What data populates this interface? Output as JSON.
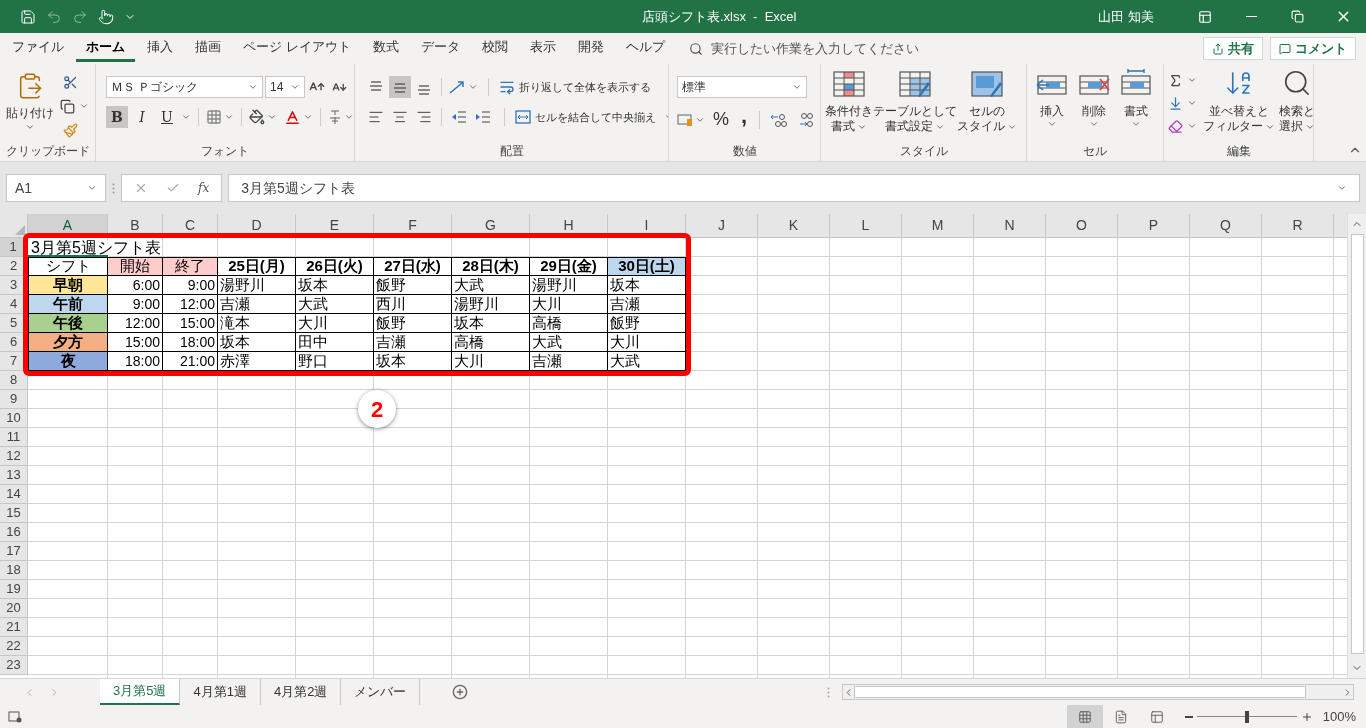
{
  "title_bar": {
    "document": "店頭シフト表.xlsx  -  Excel",
    "user": "山田 知美"
  },
  "ribbon_tabs": [
    {
      "label": "ファイル",
      "selected": false
    },
    {
      "label": "ホーム",
      "selected": true
    },
    {
      "label": "挿入",
      "selected": false
    },
    {
      "label": "描画",
      "selected": false
    },
    {
      "label": "ページ レイアウト",
      "selected": false
    },
    {
      "label": "数式",
      "selected": false
    },
    {
      "label": "データ",
      "selected": false
    },
    {
      "label": "校閲",
      "selected": false
    },
    {
      "label": "表示",
      "selected": false
    },
    {
      "label": "開発",
      "selected": false
    },
    {
      "label": "ヘルプ",
      "selected": false
    }
  ],
  "tell_me": {
    "placeholder": "実行したい作業を入力してください"
  },
  "share_button": "共有",
  "comment_button": "コメント",
  "clipboard": {
    "paste": "貼り付け",
    "group": "クリップボード"
  },
  "font": {
    "name": "ＭＳ Ｐゴシック",
    "size": "14",
    "toggles": [
      {
        "label": "B",
        "pressed": true
      },
      {
        "label": "I",
        "pressed": false
      },
      {
        "label": "U",
        "pressed": false
      }
    ],
    "group": "フォント"
  },
  "alignment": {
    "vertical": [
      {
        "kind": "top",
        "selected": false
      },
      {
        "kind": "middle",
        "selected": true
      },
      {
        "kind": "bottom",
        "selected": false
      }
    ],
    "horizontal": [
      {
        "kind": "left",
        "selected": false
      },
      {
        "kind": "center",
        "selected": false
      },
      {
        "kind": "right",
        "selected": false
      }
    ],
    "wrap": "折り返して全体を表示する",
    "merge": "セルを結合して中央揃え",
    "group": "配置"
  },
  "number": {
    "format": "標準",
    "percent": "%",
    "comma": ",",
    "group": "数値"
  },
  "styles": {
    "buttons": [
      {
        "kind": "conditional",
        "lines": [
          "条件付き",
          "書式"
        ]
      },
      {
        "kind": "table",
        "lines": [
          "テーブルとして",
          "書式設定"
        ]
      },
      {
        "kind": "cell",
        "lines": [
          "セルの",
          "スタイル"
        ]
      }
    ],
    "group": "スタイル"
  },
  "cells": {
    "buttons": [
      {
        "kind": "insert",
        "label": "挿入"
      },
      {
        "kind": "delete",
        "label": "削除"
      },
      {
        "kind": "format",
        "label": "書式"
      }
    ],
    "group": "セル"
  },
  "editing": {
    "buttons": [
      {
        "kind": "sort",
        "lines": [
          "並べ替えと",
          "フィルター"
        ]
      },
      {
        "kind": "find",
        "lines": [
          "検索と",
          "選択"
        ]
      }
    ],
    "group": "編集"
  },
  "formula_bar": {
    "name_box": "A1",
    "fx": "fx",
    "formula": "3月第5週シフト表"
  },
  "sheet": {
    "columns": [
      {
        "label": "A",
        "selected": true
      },
      {
        "label": "B",
        "selected": false
      },
      {
        "label": "C",
        "selected": false
      },
      {
        "label": "D",
        "selected": false
      },
      {
        "label": "E",
        "selected": false
      },
      {
        "label": "F",
        "selected": false
      },
      {
        "label": "G",
        "selected": false
      },
      {
        "label": "H",
        "selected": false
      },
      {
        "label": "I",
        "selected": false
      },
      {
        "label": "J",
        "selected": false
      },
      {
        "label": "K",
        "selected": false
      },
      {
        "label": "L",
        "selected": false
      },
      {
        "label": "M",
        "selected": false
      },
      {
        "label": "N",
        "selected": false
      },
      {
        "label": "O",
        "selected": false
      },
      {
        "label": "P",
        "selected": false
      },
      {
        "label": "Q",
        "selected": false
      },
      {
        "label": "R",
        "selected": false
      }
    ],
    "row_numbers": [
      {
        "label": "1",
        "selected": true
      },
      {
        "label": "2",
        "selected": false
      },
      {
        "label": "3",
        "selected": false
      },
      {
        "label": "4",
        "selected": false
      },
      {
        "label": "5",
        "selected": false
      },
      {
        "label": "6",
        "selected": false
      },
      {
        "label": "7",
        "selected": false
      },
      {
        "label": "8",
        "selected": false
      },
      {
        "label": "9",
        "selected": false
      },
      {
        "label": "10",
        "selected": false
      },
      {
        "label": "11",
        "selected": false
      },
      {
        "label": "12",
        "selected": false
      },
      {
        "label": "13",
        "selected": false
      },
      {
        "label": "14",
        "selected": false
      },
      {
        "label": "15",
        "selected": false
      },
      {
        "label": "16",
        "selected": false
      },
      {
        "label": "17",
        "selected": false
      },
      {
        "label": "18",
        "selected": false
      },
      {
        "label": "19",
        "selected": false
      },
      {
        "label": "20",
        "selected": false
      },
      {
        "label": "21",
        "selected": false
      },
      {
        "label": "22",
        "selected": false
      },
      {
        "label": "23",
        "selected": false
      }
    ],
    "title": "3月第5週シフト表",
    "header": [
      {
        "text": "シフト"
      },
      {
        "text": "開始",
        "color": "#ffcccc"
      },
      {
        "text": "終了",
        "color": "#ffcccc"
      },
      {
        "text": "25日(月)"
      },
      {
        "text": "26日(火)"
      },
      {
        "text": "27日(水)"
      },
      {
        "text": "28日(木)"
      },
      {
        "text": "29日(金)"
      },
      {
        "text": "30日(土)",
        "color": "#bdd7ee"
      }
    ],
    "rows": [
      {
        "shift": "早朝",
        "color": "#ffe699",
        "start": "6:00",
        "end": "9:00",
        "names": [
          "湯野川",
          "坂本",
          "飯野",
          "大武",
          "湯野川",
          "坂本"
        ]
      },
      {
        "shift": "午前",
        "color": "#bdd7ee",
        "start": "9:00",
        "end": "12:00",
        "names": [
          "吉瀬",
          "大武",
          "西川",
          "湯野川",
          "大川",
          "吉瀬"
        ]
      },
      {
        "shift": "午後",
        "color": "#a9d08e",
        "start": "12:00",
        "end": "15:00",
        "names": [
          "滝本",
          "大川",
          "飯野",
          "坂本",
          "高橋",
          "飯野"
        ]
      },
      {
        "shift": "夕方",
        "color": "#f4b084",
        "start": "15:00",
        "end": "18:00",
        "names": [
          "坂本",
          "田中",
          "吉瀬",
          "高橋",
          "大武",
          "大川"
        ]
      },
      {
        "shift": "夜",
        "color": "#8ea9db",
        "start": "18:00",
        "end": "21:00",
        "names": [
          "赤澤",
          "野口",
          "坂本",
          "大川",
          "吉瀬",
          "大武"
        ]
      }
    ]
  },
  "annotation": {
    "label": "2"
  },
  "sheet_tabs": [
    {
      "label": "3月第5週",
      "selected": true
    },
    {
      "label": "4月第1週",
      "selected": false
    },
    {
      "label": "4月第2週",
      "selected": false
    },
    {
      "label": "メンバー",
      "selected": false
    }
  ],
  "status_bar": {
    "views": [
      {
        "kind": "normal",
        "selected": true
      },
      {
        "kind": "layout",
        "selected": false
      },
      {
        "kind": "pagebreak",
        "selected": false
      }
    ],
    "zoom": {
      "label": "100%",
      "level": 0.5
    }
  }
}
